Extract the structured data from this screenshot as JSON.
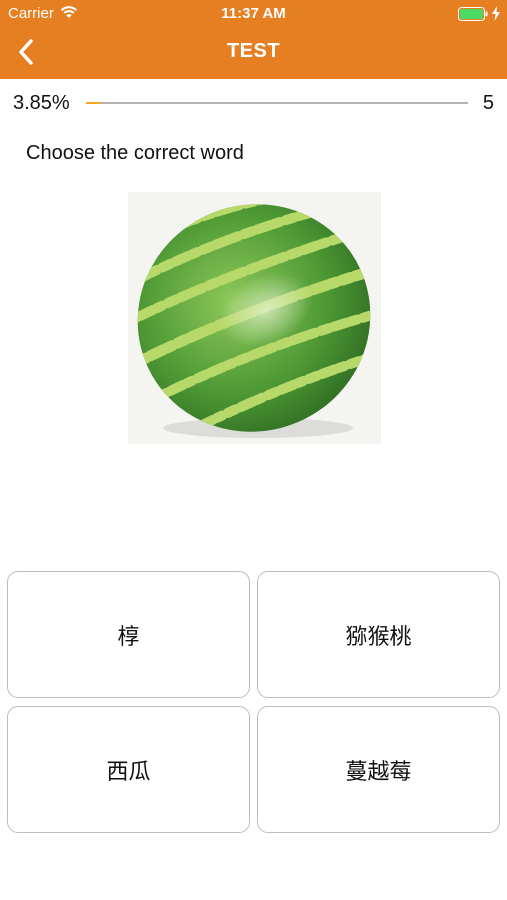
{
  "status_bar": {
    "carrier": "Carrier",
    "time": "11:37 AM"
  },
  "nav": {
    "back_icon": "chevron-left-icon",
    "title": "TEST"
  },
  "progress": {
    "percent_label": "3.85%",
    "fraction": 0.0385,
    "total": "5"
  },
  "question": {
    "prompt": "Choose the correct word",
    "image": "watermelon"
  },
  "answers": [
    {
      "label": "椁"
    },
    {
      "label": "猕猴桃"
    },
    {
      "label": "西瓜"
    },
    {
      "label": "蔓越莓"
    }
  ],
  "colors": {
    "header": "#e67f22",
    "progress_fill": "#f5a623",
    "battery": "#4cd964"
  }
}
